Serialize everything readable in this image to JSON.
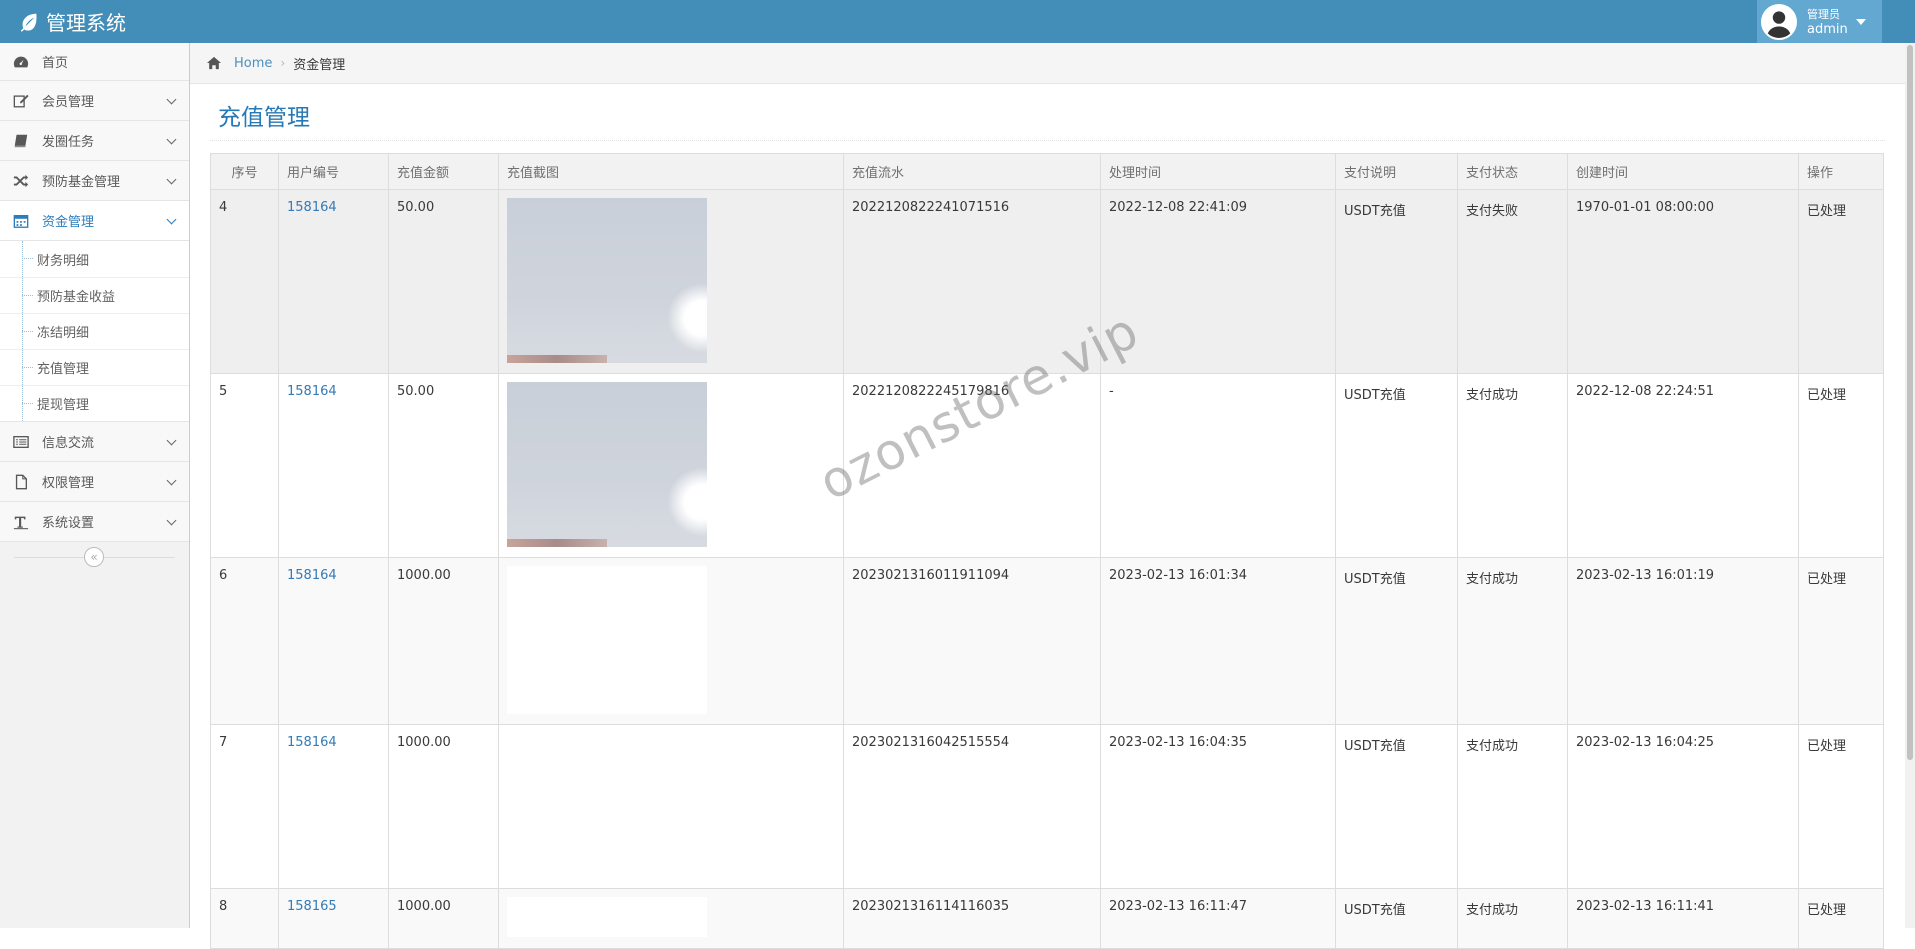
{
  "app": {
    "title": "管理系统"
  },
  "user": {
    "welcome": "管理员",
    "name": "admin"
  },
  "sidebar": {
    "items": [
      {
        "label": "首页",
        "icon": "dashboard-icon"
      },
      {
        "label": "会员管理",
        "icon": "edit-icon"
      },
      {
        "label": "发圈任务",
        "icon": "book-icon"
      },
      {
        "label": "预防基金管理",
        "icon": "random-icon"
      },
      {
        "label": "资金管理",
        "icon": "calendar-icon"
      },
      {
        "label": "信息交流",
        "icon": "list-icon"
      },
      {
        "label": "权限管理",
        "icon": "file-icon"
      },
      {
        "label": "系统设置",
        "icon": "text-icon"
      }
    ],
    "submenu": [
      "财务明细",
      "预防基金收益",
      "冻结明细",
      "充值管理",
      "提现管理"
    ],
    "collapse_glyph": "«"
  },
  "breadcrumb": {
    "home": "Home",
    "current": "资金管理"
  },
  "page": {
    "title": "充值管理"
  },
  "table": {
    "headers": [
      "序号",
      "用户编号",
      "充值金额",
      "充值截图",
      "充值流水",
      "处理时间",
      "支付说明",
      "支付状态",
      "创建时间",
      "操作"
    ],
    "rows": [
      {
        "seq": "4",
        "user": "158164",
        "amount": "50.00",
        "shot": "photo",
        "flow": "20221208222410715​16",
        "processed": "2022-12-08 22:41:09",
        "desc": "USDT充值",
        "status": "支付失败",
        "created": "1970-01-01 08:00:00",
        "op": "已处理"
      },
      {
        "seq": "5",
        "user": "158164",
        "amount": "50.00",
        "shot": "photo",
        "flow": "2022120822245179816",
        "processed": "-",
        "desc": "USDT充值",
        "status": "支付成功",
        "created": "2022-12-08 22:24:51",
        "op": "已处理"
      },
      {
        "seq": "6",
        "user": "158164",
        "amount": "1000.00",
        "shot": "blank",
        "flow": "2023021316011911094",
        "processed": "2023-02-13 16:01:34",
        "desc": "USDT充值",
        "status": "支付成功",
        "created": "2023-02-13 16:01:19",
        "op": "已处理"
      },
      {
        "seq": "7",
        "user": "158164",
        "amount": "1000.00",
        "shot": "none",
        "flow": "2023021316042515554",
        "processed": "2023-02-13 16:04:35",
        "desc": "USDT充值",
        "status": "支付成功",
        "created": "2023-02-13 16:04:25",
        "op": "已处理"
      },
      {
        "seq": "8",
        "user": "158165",
        "amount": "1000.00",
        "shot": "blank",
        "flow": "2023021316114116035",
        "processed": "2023-02-13 16:11:47",
        "desc": "USDT充值",
        "status": "支付成功",
        "created": "2023-02-13 16:11:41",
        "op": "已处理"
      }
    ]
  },
  "watermark": "ozonstore.vip",
  "colors": {
    "navbar": "#438eb9",
    "accent": "#2679b5",
    "link": "#337ab7"
  }
}
